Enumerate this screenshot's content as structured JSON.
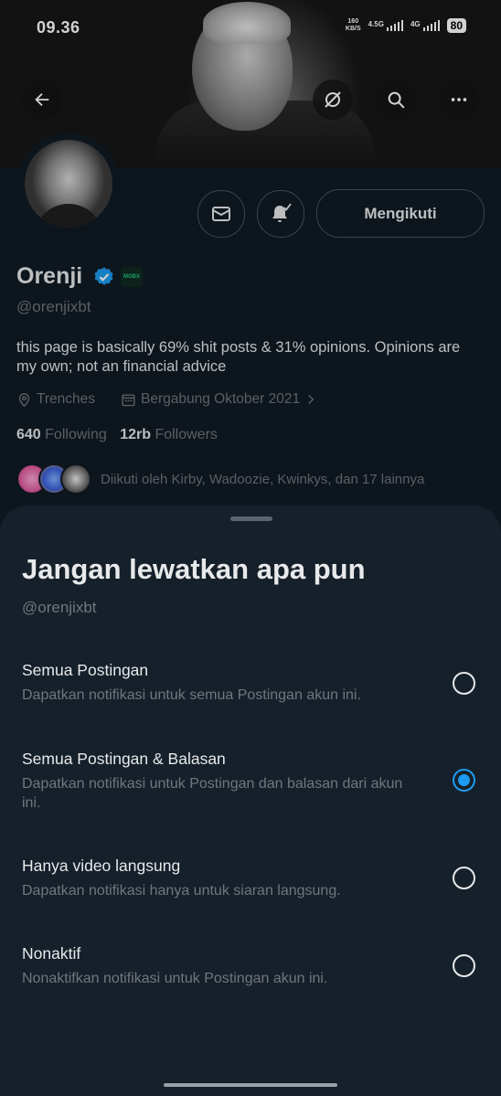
{
  "status_bar": {
    "time": "09.36",
    "net_speed_value": "160",
    "net_speed_unit": "KB/S",
    "signal1_label": "4.5G",
    "signal2_label": "4G",
    "battery": "80"
  },
  "profile": {
    "name": "Orenji",
    "affiliate_badge": "MOBX",
    "handle": "@orenjixbt",
    "bio": "this page is basically 69% shit posts & 31% opinions. Opinions are my own; not an financial advice",
    "location": "Trenches",
    "joined": "Bergabung Oktober 2021",
    "following_count": "640",
    "following_label": "Following",
    "followers_count": "12rb",
    "followers_label": "Followers",
    "followed_by": "Diikuti oleh Kirby, Wadoozie, Kwinkys, dan 17 lainnya",
    "follow_button_label": "Mengikuti"
  },
  "sheet": {
    "title": "Jangan lewatkan apa pun",
    "handle": "@orenjixbt",
    "options": [
      {
        "title": "Semua Postingan",
        "desc": "Dapatkan notifikasi untuk semua Postingan akun ini.",
        "selected": false
      },
      {
        "title": "Semua Postingan & Balasan",
        "desc": "Dapatkan notifikasi untuk Postingan dan balasan dari akun ini.",
        "selected": true
      },
      {
        "title": "Hanya video langsung",
        "desc": "Dapatkan notifikasi hanya untuk siaran langsung.",
        "selected": false
      },
      {
        "title": "Nonaktif",
        "desc": "Nonaktifkan notifikasi untuk Postingan akun ini.",
        "selected": false
      }
    ]
  },
  "icons": {
    "back": "arrow-left-icon",
    "grok": "grok-icon",
    "search": "search-icon",
    "more": "more-horizontal-icon",
    "message": "mail-icon",
    "notify": "bell-check-icon",
    "location": "location-pin-icon",
    "calendar": "calendar-icon",
    "verified": "verified-badge-icon"
  },
  "colors": {
    "accent": "#1d9bf0",
    "background": "#101a24",
    "sheet": "#16202b",
    "text_primary": "#e7e9ea",
    "text_secondary": "#71767b"
  }
}
